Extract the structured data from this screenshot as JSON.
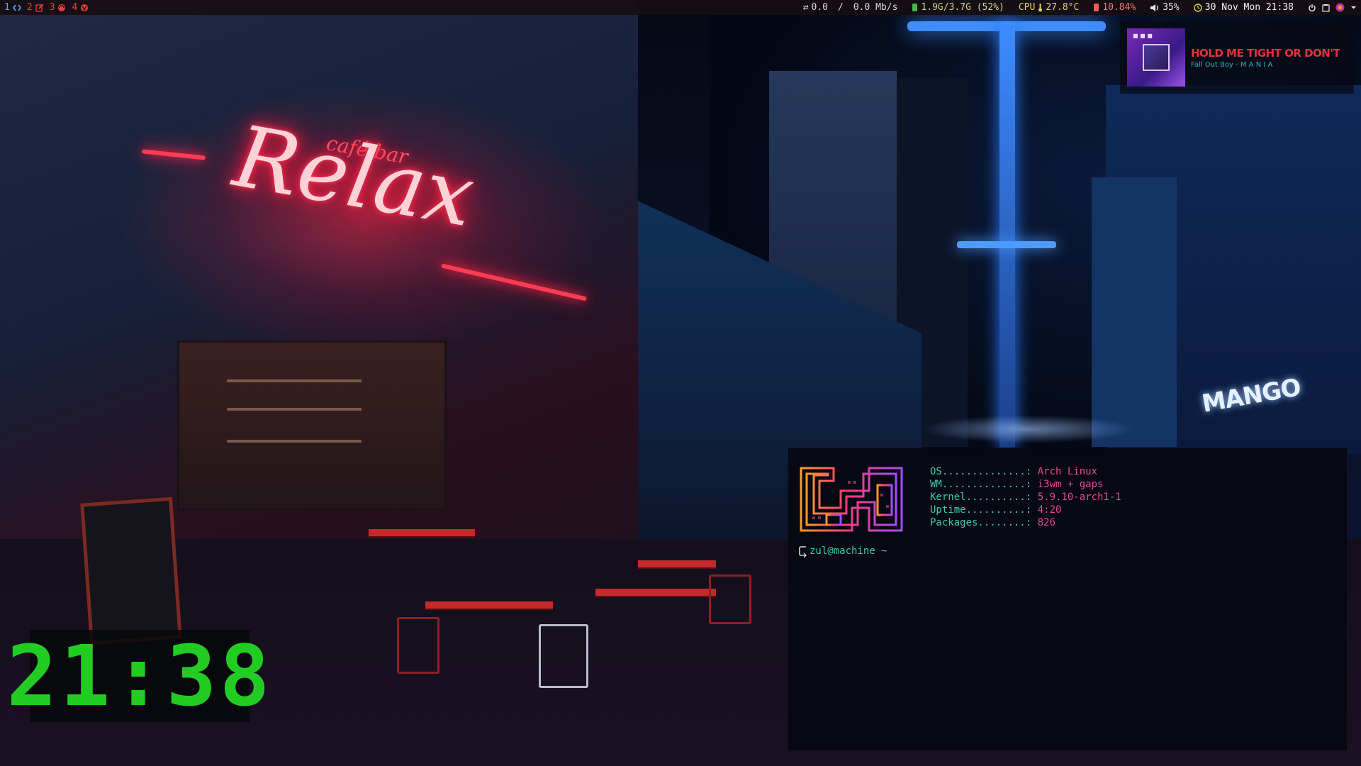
{
  "workspaces": [
    {
      "num": "1",
      "icon": "code-icon"
    },
    {
      "num": "2",
      "icon": "edit-icon"
    },
    {
      "num": "3",
      "icon": "browser-icon"
    },
    {
      "num": "4",
      "icon": "vivaldi-icon"
    }
  ],
  "statusbar": {
    "net_up": "0.0",
    "net_sep": "/",
    "net_down": "0.0 Mb/s",
    "memory": "1.9G/3.7G (52%)",
    "cpu_label": "CPU",
    "cpu_temp": "27.8°C",
    "cpu_load": "10.84%",
    "volume": "35%",
    "datetime": "30 Nov Mon 21:38"
  },
  "now_playing": {
    "title": "HOLD ME TIGHT OR DON'T",
    "artist": "Fall Out Boy - M A N I A"
  },
  "clock": {
    "time": "21:38"
  },
  "terminal": {
    "info": [
      {
        "key": "OS..............: ",
        "value": "Arch Linux"
      },
      {
        "key": "WM..............: ",
        "value": "i3wm + gaps"
      },
      {
        "key": "Kernel..........: ",
        "value": "5.9.10-arch1-1"
      },
      {
        "key": "Uptime..........: ",
        "value": "4:20"
      },
      {
        "key": "Packages........: ",
        "value": "826"
      }
    ],
    "prompt_user": "zul@machine",
    "prompt_dir": "~"
  },
  "colors": {
    "accent_blue": "#57a7ff",
    "accent_red": "#e84040",
    "clock_green": "#22cc22",
    "terminal_key": "#40c8b0",
    "terminal_value": "#e04a9a"
  }
}
